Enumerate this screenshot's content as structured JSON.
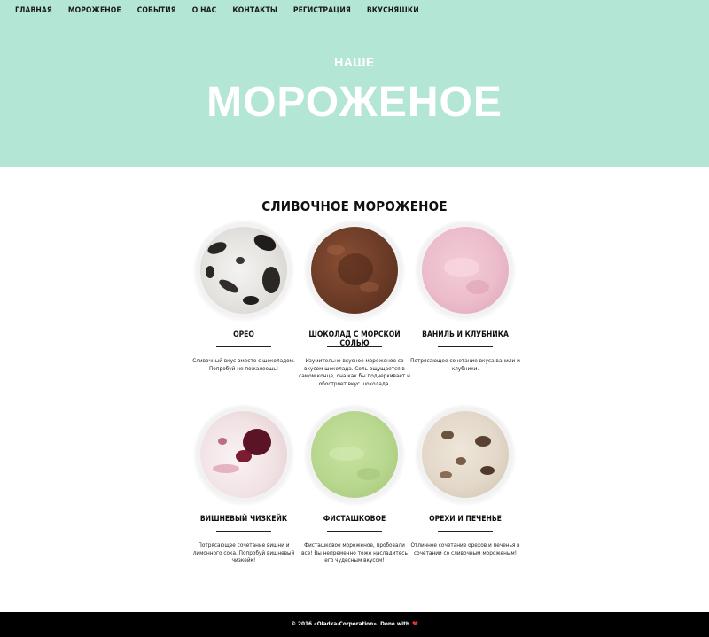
{
  "nav": {
    "items": [
      "ГЛАВНАЯ",
      "МОРОЖЕНОЕ",
      "СОБЫТИЯ",
      "О НАС",
      "КОНТАКТЫ",
      "РЕГИСТРАЦИЯ",
      "ВКУСНЯШКИ"
    ]
  },
  "hero": {
    "subtitle": "НАШЕ",
    "title": "МОРОЖЕНОЕ",
    "background_color": "#b3e6d4"
  },
  "section": {
    "title": "СЛИВОЧНОЕ МОРОЖЕНОЕ"
  },
  "flavors": [
    {
      "name": "ОРЕО",
      "description": "Сливочный вкус вместе с шоколадом. Попробуй не пожалеешь!",
      "color": "#e9e7e4",
      "image": "oreo-ice-cream-scoop"
    },
    {
      "name": "ШОКОЛАД С МОРСКОЙ СОЛЬЮ",
      "description": "Изумительно вкусное мороженое со вкусом шоколада. Соль ощущается в самом конце, она как бы подчеркивает и обостряет вкус шоколада.",
      "color": "#6e3d28",
      "image": "chocolate-ice-cream-scoop"
    },
    {
      "name": "ВАНИЛЬ И КЛУБНИКА",
      "description": "Потрясающее сочетание вкуса ванили и клубники.",
      "color": "#ecbccb",
      "image": "strawberry-ice-cream-scoop"
    },
    {
      "name": "ВИШНЕВЫЙ ЧИЗКЕЙК",
      "description": "Потрясающее сочетание вишни и лимонного сока. Попробуй вишневый чизкейк!",
      "color": "#f1e2e4",
      "image": "cherry-cheesecake-ice-cream-scoop"
    },
    {
      "name": "ФИСТАШКОВОЕ",
      "description": "Фисташковое мороженое, пробовали все! Вы непременно тоже насладитесь его чудесным вкусом!",
      "color": "#b8d78e",
      "image": "pistachio-ice-cream-scoop"
    },
    {
      "name": "ОРЕХИ И ПЕЧЕНЬЕ",
      "description": "Отличное сочетание орехов и печенья в сочетании со сливочным мороженым!",
      "color": "#e3d8c9",
      "image": "nuts-cookies-ice-cream-scoop"
    }
  ],
  "footer": {
    "text": "© 2016 «Oladka-Corporation». Done with",
    "icon": "heart-icon",
    "heart_color": "#e0322d"
  }
}
